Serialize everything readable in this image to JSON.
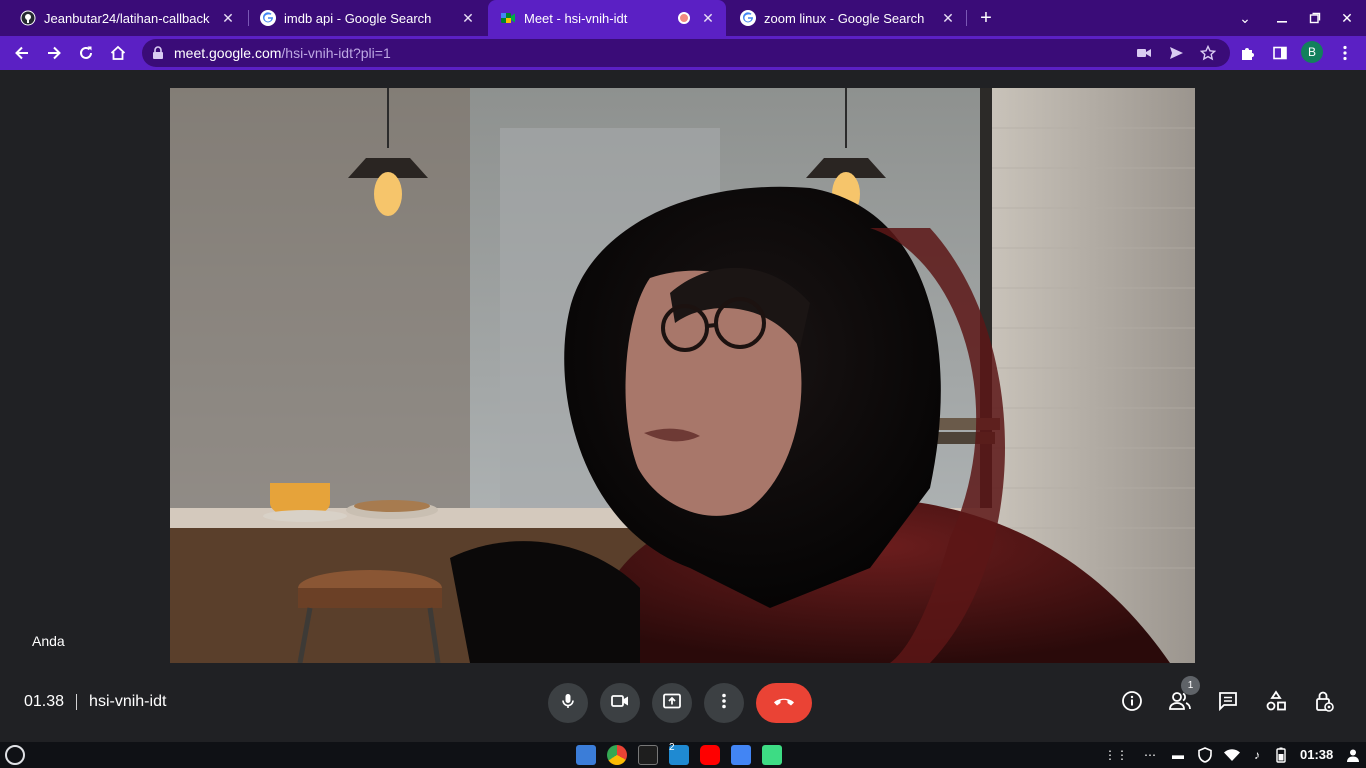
{
  "browser": {
    "tabs": [
      {
        "title": "Jeanbutar24/latihan-callback",
        "favicon": "github-icon",
        "active": false
      },
      {
        "title": "imdb api - Google Search",
        "favicon": "google-icon",
        "active": false
      },
      {
        "title": "Meet - hsi-vnih-idt",
        "favicon": "meet-icon",
        "active": true,
        "recording_dot": true
      },
      {
        "title": "zoom linux - Google Search",
        "favicon": "google-icon",
        "active": false
      }
    ],
    "new_tab_label": "+",
    "url_host": "meet.google.com",
    "url_path": "/hsi-vnih-idt?pli=1",
    "profile_initial": "B",
    "colors": {
      "tabstrip": "#3a0c78",
      "active_tab": "#5b20c4",
      "toolbar": "#5b20c4",
      "omnibox": "#3a0c78"
    }
  },
  "meet": {
    "self_label": "Anda",
    "time": "01.38",
    "meeting_code": "hsi-vnih-idt",
    "participant_count": "1",
    "controls": [
      "mic-icon",
      "camera-icon",
      "present-screen-icon",
      "more-options-icon",
      "end-call-icon"
    ],
    "side_controls": [
      "info-icon",
      "people-icon",
      "chat-icon",
      "activities-icon",
      "host-controls-icon"
    ],
    "colors": {
      "end_call": "#ea4335",
      "control_bg": "#3c4043"
    }
  },
  "shelf": {
    "apps": [
      "files-icon",
      "chrome-icon",
      "terminal-icon",
      "vscode-icon",
      "youtube-icon",
      "docs-icon",
      "android-icon"
    ],
    "vscode_badge": "2",
    "clock": "01:38"
  }
}
